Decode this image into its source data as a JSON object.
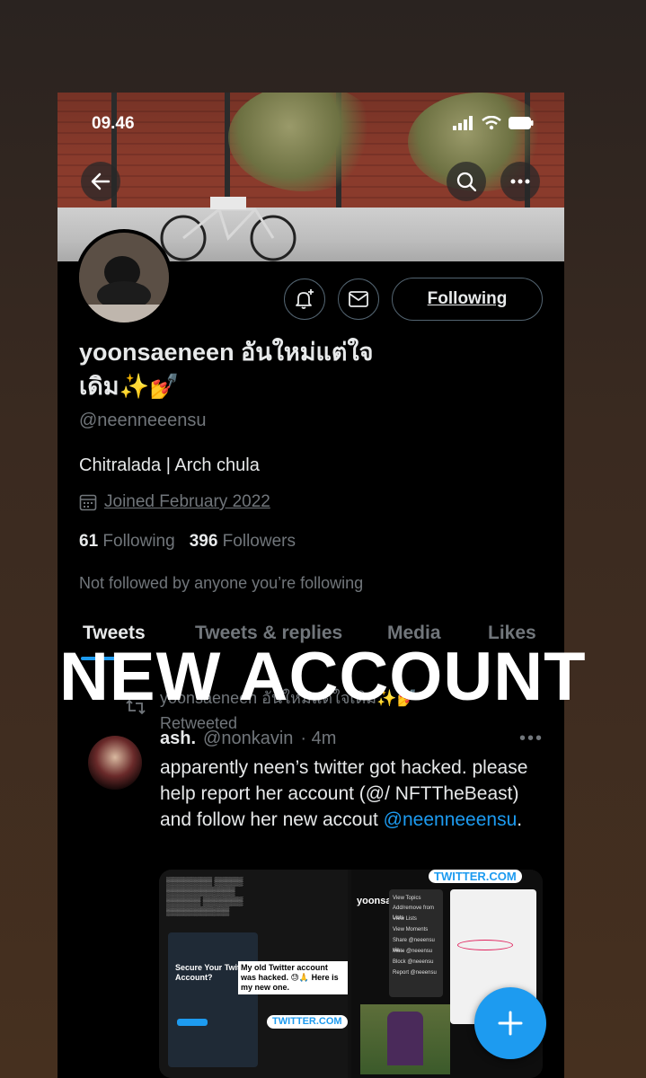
{
  "status_bar": {
    "time": "09.46"
  },
  "profile": {
    "display_name": "yoonsaeneen อันใหม่แต่ใจเดิม✨💅",
    "handle": "@neenneeensu",
    "bio": "Chitralada | Arch chula",
    "joined": "Joined February 2022",
    "following_count": "61",
    "following_label": "Following",
    "followers_count": "396",
    "followers_label": "Followers",
    "not_followed_text": "Not followed by anyone you’re following",
    "following_button": "Following"
  },
  "tabs": [
    {
      "label": "Tweets",
      "active": true
    },
    {
      "label": "Tweets & replies",
      "active": false
    },
    {
      "label": "Media",
      "active": false
    },
    {
      "label": "Likes",
      "active": false
    }
  ],
  "overlay": {
    "text": "NEW ACCOUNT"
  },
  "retweet": {
    "text": "yoonsaeneen อันใหม่แต่ใจเดิม✨💅 Retweeted"
  },
  "tweet": {
    "name": "ash.",
    "handle": "@nonkavin",
    "time": "· 4m",
    "text_main": "apparently neen’s twitter got hacked. please help report her account (@/ NFTTheBeast) and follow her new accout ",
    "mention": "@neenneeensu",
    "text_end": "."
  },
  "media": {
    "left_caption": "My old Twitter account was hacked. 😓🙏 Here is my new one.",
    "left_link": "TWITTER.COM",
    "left_secure": "Secure Your Twitter Account?",
    "right_link": "TWITTER.COM",
    "right_menu": [
      "View Topics",
      "Add/remove from Lists",
      "View Lists",
      "View Moments",
      "Share @neeensu via...",
      "Mute @neeensu",
      "Block @neeensu",
      "Report @neeensu"
    ],
    "right_name": "yoonsaeen"
  },
  "colors": {
    "accent": "#1d9bf0",
    "background": "#000000",
    "muted": "#71767b"
  }
}
